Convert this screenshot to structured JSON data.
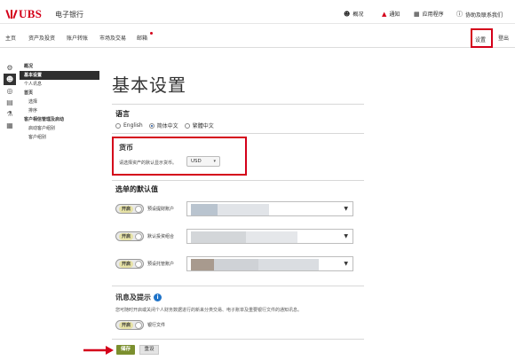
{
  "header": {
    "brand": "UBS",
    "app_name": "电子银行",
    "utilities": [
      {
        "label": "概况",
        "icon": "person-icon"
      },
      {
        "label": "通知",
        "icon": "bell-icon"
      },
      {
        "label": "应用程序",
        "icon": "grid-icon"
      },
      {
        "label": "协助及联系我们",
        "icon": "help-icon"
      }
    ]
  },
  "nav": {
    "items": [
      "主页",
      "资产及投资",
      "账户转账",
      "市场及交易",
      "邮箱"
    ],
    "settings": "设置",
    "logout": "登出"
  },
  "sidebar": {
    "rail_icons": [
      "gear-icon",
      "user-icon",
      "globe-icon",
      "document-icon",
      "hierarchy-icon",
      "table-icon"
    ],
    "items": [
      {
        "label": "概况",
        "kind": "head"
      },
      {
        "label": "基本设置",
        "kind": "active"
      },
      {
        "label": "个人讯息",
        "kind": "normal"
      },
      {
        "label": "首页",
        "kind": "head"
      },
      {
        "label": "选择",
        "kind": "sub"
      },
      {
        "label": "排序",
        "kind": "sub"
      },
      {
        "label": "客户相信管理及启动",
        "kind": "head"
      },
      {
        "label": "启动客户组别",
        "kind": "sub"
      },
      {
        "label": "客户组别",
        "kind": "sub"
      }
    ]
  },
  "main": {
    "title": "基本设置",
    "language": {
      "title": "语言",
      "options": [
        "English",
        "简体中文",
        "繁體中文"
      ],
      "selected": "简体中文"
    },
    "currency": {
      "title": "货币",
      "prompt": "请选择资产的默认显示货币。",
      "value": "USD"
    },
    "defaults": {
      "title": "选单的默认值",
      "rows": [
        {
          "toggle": "开启",
          "label": "预设提财账户"
        },
        {
          "toggle": "开启",
          "label": "默认投资组合"
        },
        {
          "toggle": "开启",
          "label": "预设托管账户"
        }
      ]
    },
    "info": {
      "title": "讯息及提示",
      "text": "您可随时开启或关闭个人财务数据进行的新来分类交易、电子账单及重要银行文件的通知讯息。",
      "toggle": "开启",
      "toggle_label": "银行文件"
    },
    "buttons": {
      "save": "储存",
      "reset": "重设"
    }
  },
  "colors": {
    "brand_red": "#d4001a",
    "save_green": "#7b8f2e",
    "info_blue": "#1f73c8"
  }
}
